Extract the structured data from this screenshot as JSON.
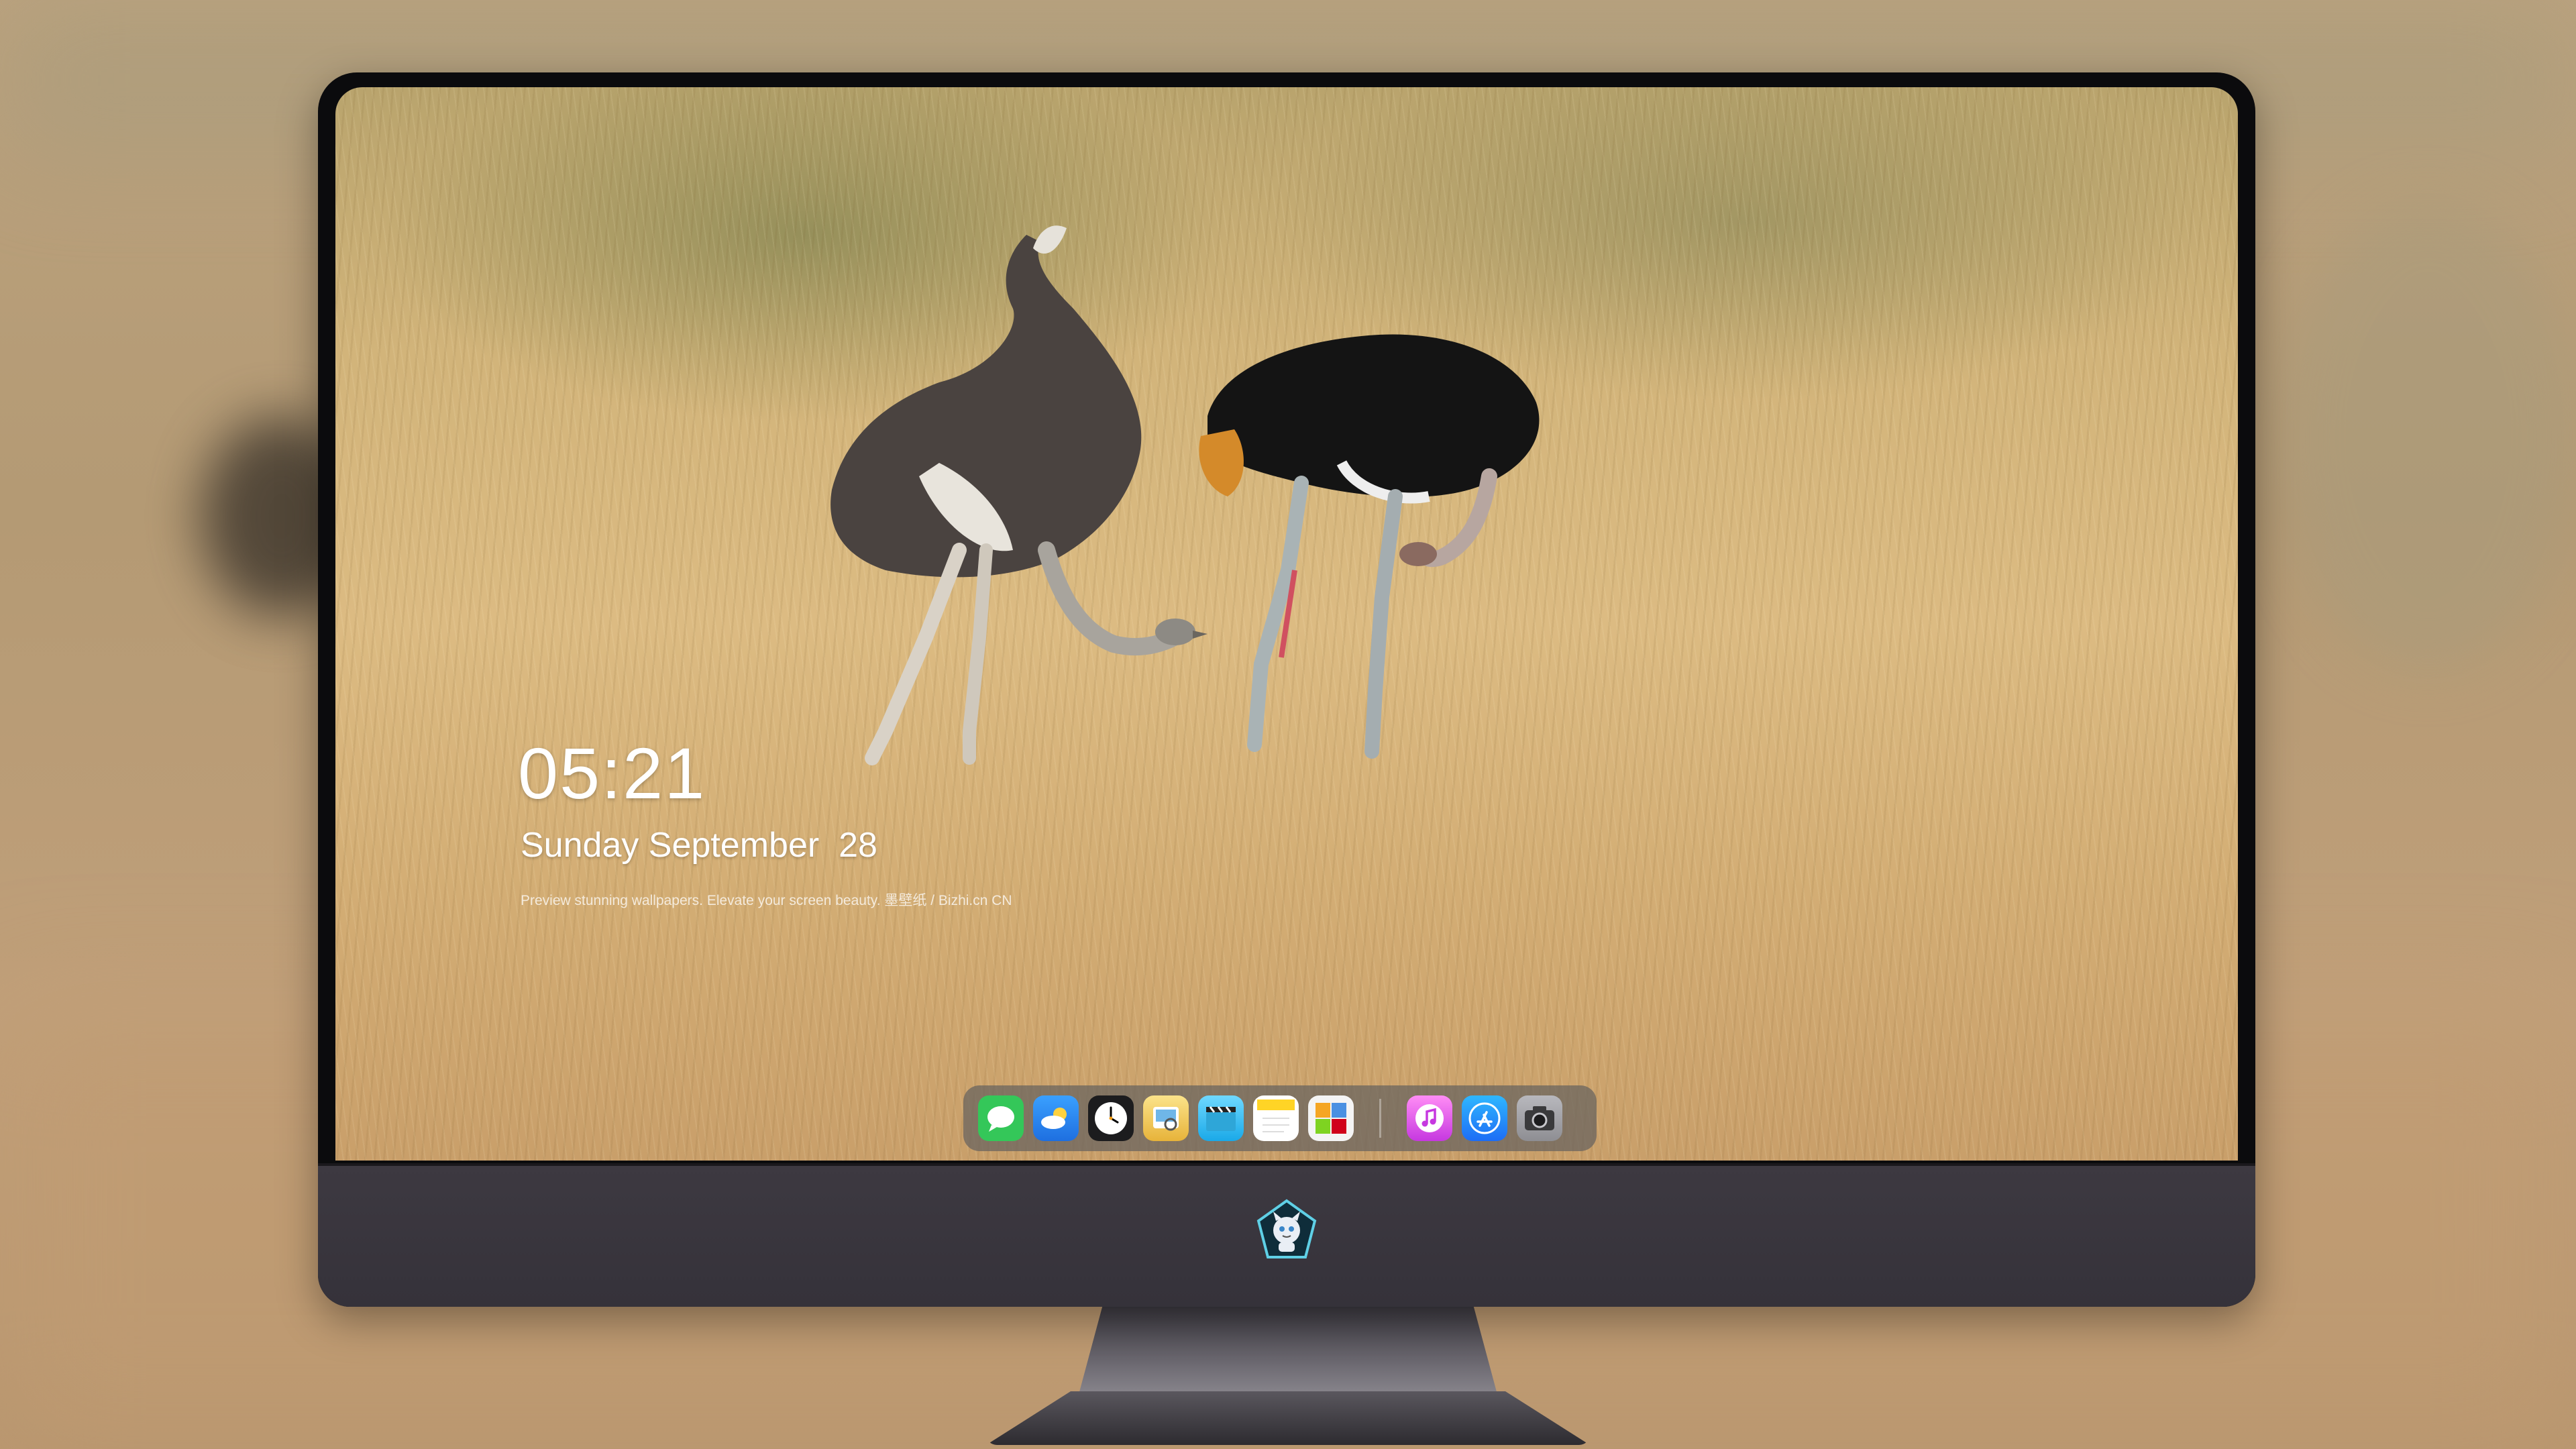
{
  "lockscreen": {
    "time": "05:21",
    "date": "Sunday September  28",
    "tagline": "Preview stunning wallpapers. Elevate your screen beauty. 墨壁纸 / Bizhi.cn CN"
  },
  "dock": {
    "apps": [
      {
        "icon": "messages-icon",
        "color": "#34c759"
      },
      {
        "icon": "weather-icon",
        "color": "#2f8cff"
      },
      {
        "icon": "clock-icon",
        "color": "#1c1c1e"
      },
      {
        "icon": "preview-icon",
        "color": "#f2c744"
      },
      {
        "icon": "video-clapper-icon",
        "color": "#1aa9e8"
      },
      {
        "icon": "notes-icon",
        "color": "#ffd426"
      },
      {
        "icon": "photos-widget-icon",
        "color": "#4caf50"
      },
      {
        "icon": "music-icon",
        "color": "#d444e8"
      },
      {
        "icon": "app-store-icon",
        "color": "#1d8df5"
      },
      {
        "icon": "camera-icon",
        "color": "#8e8e93"
      }
    ]
  },
  "monitor": {
    "logo_icon": "mascot-logo-icon"
  }
}
